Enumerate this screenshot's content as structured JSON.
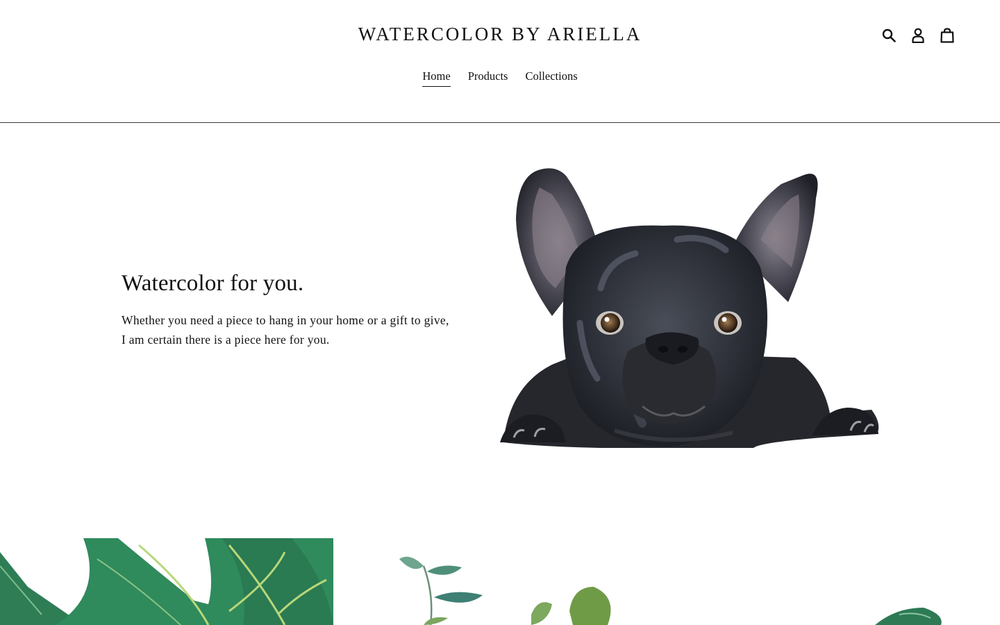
{
  "header": {
    "logo": "WATERCOLOR BY ARIELLA",
    "icons": [
      "search-icon",
      "account-icon",
      "cart-icon"
    ]
  },
  "nav": {
    "items": [
      {
        "label": "Home",
        "active": true
      },
      {
        "label": "Products",
        "active": false
      },
      {
        "label": "Collections",
        "active": false
      }
    ]
  },
  "hero": {
    "title": "Watercolor for you.",
    "body_line1": "Whether you need a piece to hang in your home or a gift to give,",
    "body_line2": "I am certain there is a piece here for you."
  },
  "colors": {
    "text": "#111111",
    "divider": "#3a3a3a",
    "leaf_dark": "#1f6b45",
    "leaf_light": "#3e9a66",
    "eucalyptus": "#5f9a86",
    "dog_body": "#2b2d33"
  }
}
